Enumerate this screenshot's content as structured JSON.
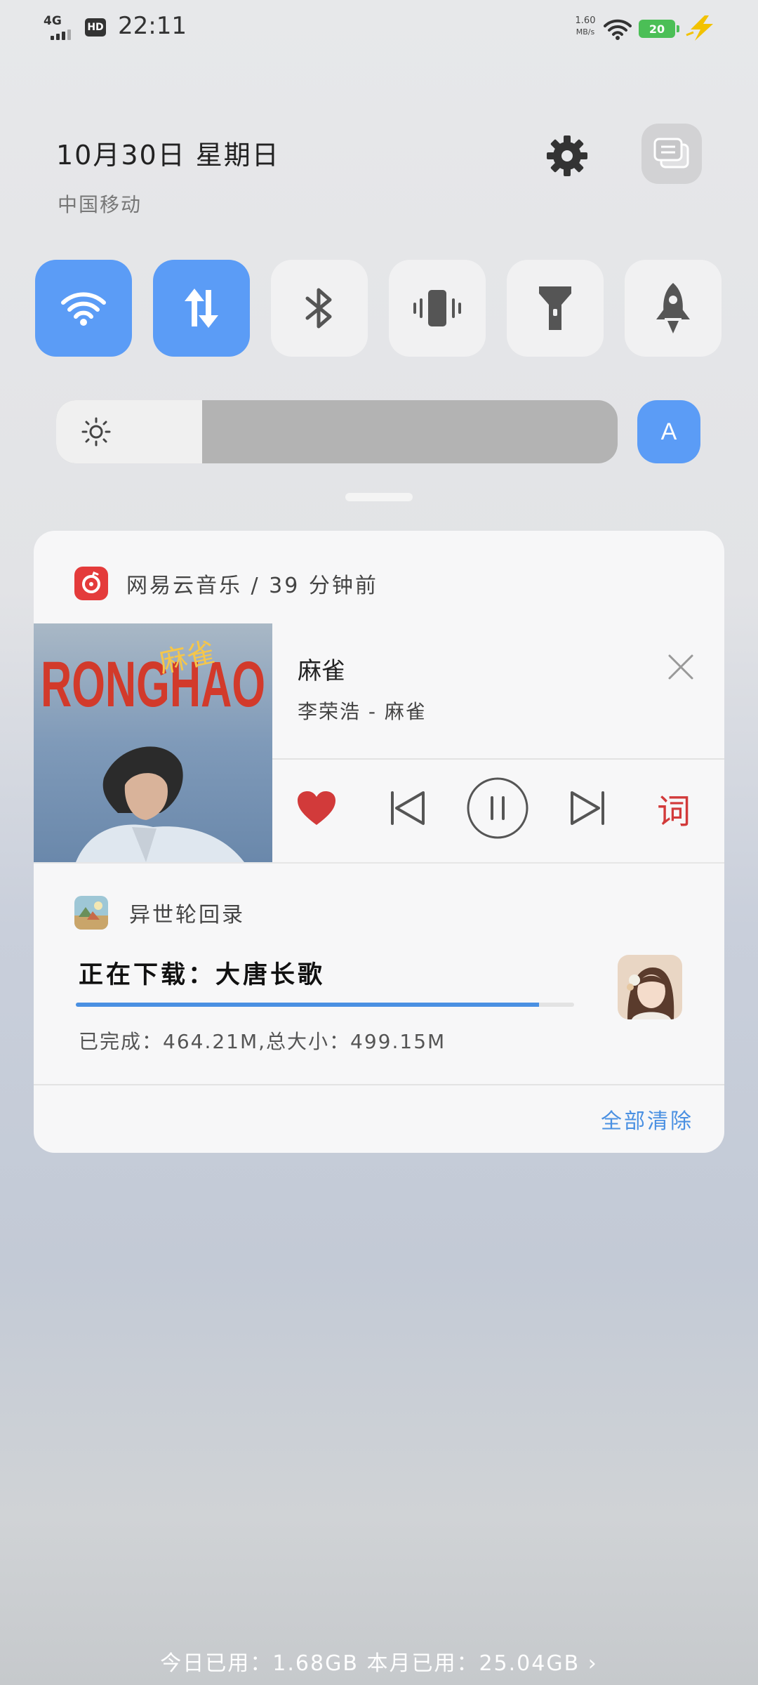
{
  "status_bar": {
    "network_type": "4G",
    "hd_label": "HD",
    "time": "22:11",
    "speed_value": "1.60",
    "speed_unit": "MB/s",
    "battery_level": "20",
    "icons": [
      "signal-icon",
      "hd-icon",
      "wifi-icon",
      "battery-icon",
      "charging-icon"
    ]
  },
  "header": {
    "date": "10月30日 星期日",
    "carrier": "中国移动",
    "icons": [
      "gear-icon",
      "edit-tiles-icon"
    ]
  },
  "quick_tiles": [
    {
      "name": "wifi",
      "icon": "wifi-icon",
      "active": true
    },
    {
      "name": "mobile-data",
      "icon": "data-arrows-icon",
      "active": true
    },
    {
      "name": "bluetooth",
      "icon": "bluetooth-icon",
      "active": false
    },
    {
      "name": "vibrate",
      "icon": "vibrate-icon",
      "active": false
    },
    {
      "name": "flashlight",
      "icon": "flashlight-icon",
      "active": false
    },
    {
      "name": "rocket",
      "icon": "rocket-icon",
      "active": false
    }
  ],
  "brightness": {
    "level": 0.26,
    "auto_label": "A"
  },
  "music_notification": {
    "app_label": "网易云音乐 / 39 分钟前",
    "album_text": "RONGHAO",
    "album_script": "麻雀",
    "song_title": "麻雀",
    "artist_line": "李荣浩 - 麻雀",
    "liked": true,
    "playing": true,
    "lyric_label": "词",
    "accent_color": "#d23a3a"
  },
  "download_notification": {
    "app_label": "异世轮回录",
    "title": "正在下载：大唐长歌",
    "progress": 0.93,
    "detail": "已完成：464.21M,总大小：499.15M"
  },
  "clear_all_label": "全部清除",
  "data_usage": "今日已用：1.68GB 本月已用：25.04GB  ›"
}
